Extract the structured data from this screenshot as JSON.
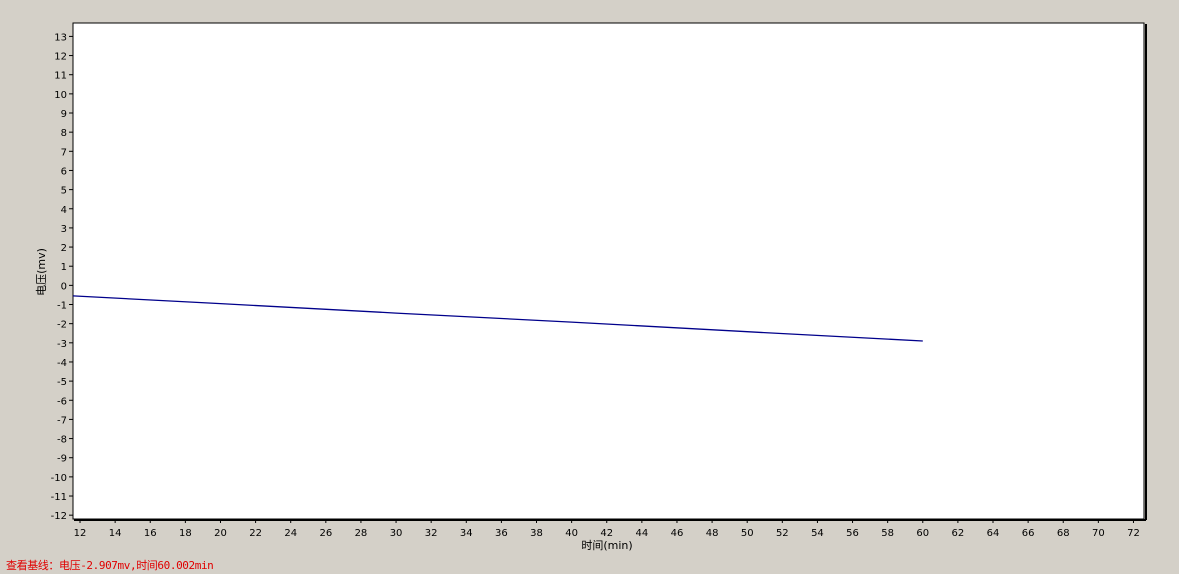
{
  "chart_data": {
    "type": "line",
    "title": "",
    "xlabel": "时间(min)",
    "ylabel": "电压(mv)",
    "xlim": [
      11.6,
      72.6
    ],
    "ylim": [
      -12.2,
      13.7
    ],
    "x_ticks": [
      12,
      14,
      16,
      18,
      20,
      22,
      24,
      26,
      28,
      30,
      32,
      34,
      36,
      38,
      40,
      42,
      44,
      46,
      48,
      50,
      52,
      54,
      56,
      58,
      60,
      62,
      64,
      66,
      68,
      70,
      72
    ],
    "y_ticks": [
      13,
      12,
      11,
      10,
      9,
      8,
      7,
      6,
      5,
      4,
      3,
      2,
      1,
      0,
      -1,
      -2,
      -3,
      -4,
      -5,
      -6,
      -7,
      -8,
      -9,
      -10,
      -11,
      -12
    ],
    "grid": false,
    "series": [
      {
        "color": "#00008b",
        "x": [
          11.6,
          20,
          30,
          40,
          50,
          60.0
        ],
        "y": [
          -0.55,
          -0.95,
          -1.45,
          -1.92,
          -2.42,
          -2.907
        ]
      }
    ]
  },
  "status": {
    "text": "查看基线：电压-2.907mv,时间60.002min"
  }
}
